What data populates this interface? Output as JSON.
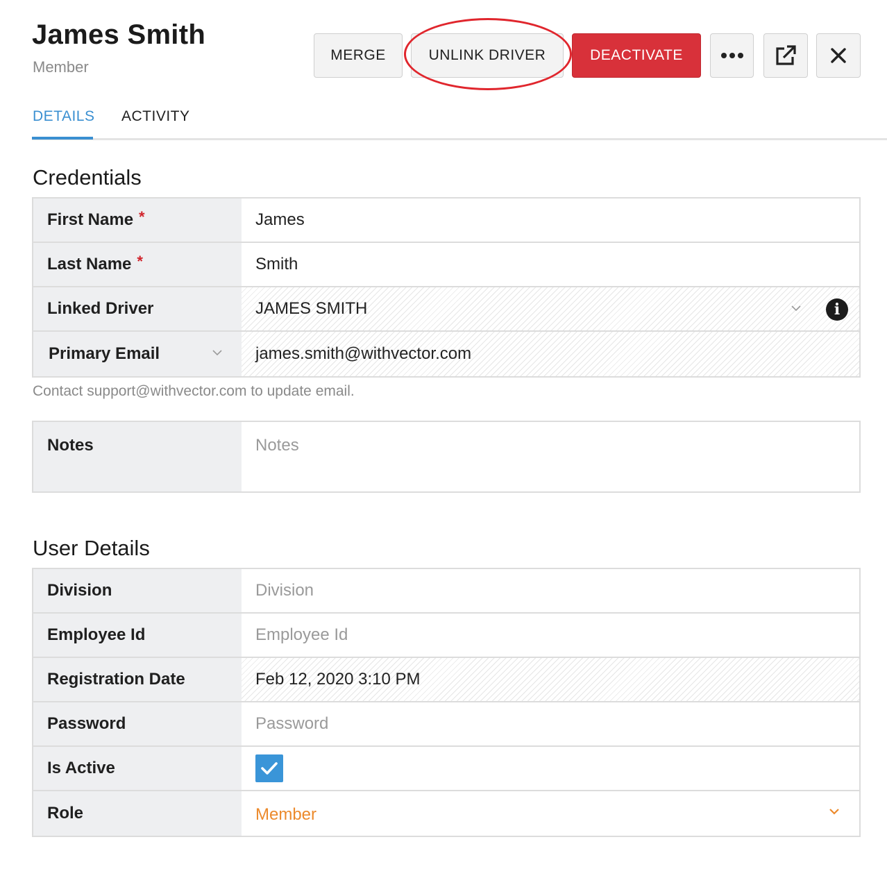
{
  "header": {
    "title": "James Smith",
    "subtitle": "Member"
  },
  "toolbar": {
    "merge_label": "MERGE",
    "unlink_label": "UNLINK DRIVER",
    "deactivate_label": "DEACTIVATE",
    "more_icon": "more-horizontal-icon",
    "open_icon": "external-link-icon",
    "close_icon": "close-icon"
  },
  "tabs": [
    {
      "label": "DETAILS",
      "active": true
    },
    {
      "label": "ACTIVITY",
      "active": false
    }
  ],
  "credentials": {
    "title": "Credentials",
    "first_name_label": "First Name",
    "first_name_value": "James",
    "last_name_label": "Last Name",
    "last_name_value": "Smith",
    "required_mark": "*",
    "linked_driver_label": "Linked Driver",
    "linked_driver_value": "JAMES SMITH",
    "primary_email_label": "Primary Email",
    "primary_email_value": "james.smith@withvector.com",
    "email_hint": "Contact support@withvector.com to update email.",
    "notes_label": "Notes",
    "notes_placeholder": "Notes"
  },
  "user_details": {
    "title": "User Details",
    "division_label": "Division",
    "division_placeholder": "Division",
    "employee_id_label": "Employee Id",
    "employee_id_placeholder": "Employee Id",
    "registration_date_label": "Registration Date",
    "registration_date_value": "Feb 12, 2020 3:10 PM",
    "password_label": "Password",
    "password_placeholder": "Password",
    "is_active_label": "Is Active",
    "is_active_checked": true,
    "role_label": "Role",
    "role_value": "Member"
  },
  "colors": {
    "accent": "#3a8fd1",
    "danger": "#d8313a",
    "role": "#ec8a2c",
    "highlight": "#e0262d"
  }
}
